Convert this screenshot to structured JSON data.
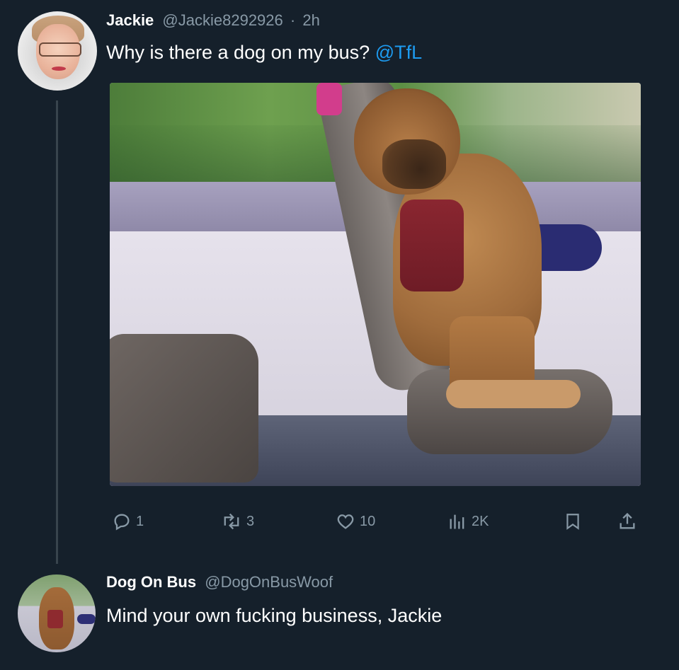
{
  "tweet1": {
    "name": "Jackie",
    "handle": "@Jackie8292926",
    "separator": "·",
    "time": "2h",
    "text": "Why is there a dog on my bus?",
    "mention": "@TfL",
    "actions": {
      "replies": "1",
      "retweets": "3",
      "likes": "10",
      "views": "2K"
    }
  },
  "tweet2": {
    "name": "Dog On Bus",
    "handle": "@DogOnBusWoof",
    "text": "Mind your own fucking business, Jackie"
  },
  "icons": {
    "reply": "reply-icon",
    "retweet": "retweet-icon",
    "like": "heart-icon",
    "views": "views-icon",
    "bookmark": "bookmark-icon",
    "share": "share-icon"
  },
  "colors": {
    "background": "#15202b",
    "muted": "#8899a6",
    "link": "#1d9bf0",
    "thread_line": "#38444d"
  }
}
